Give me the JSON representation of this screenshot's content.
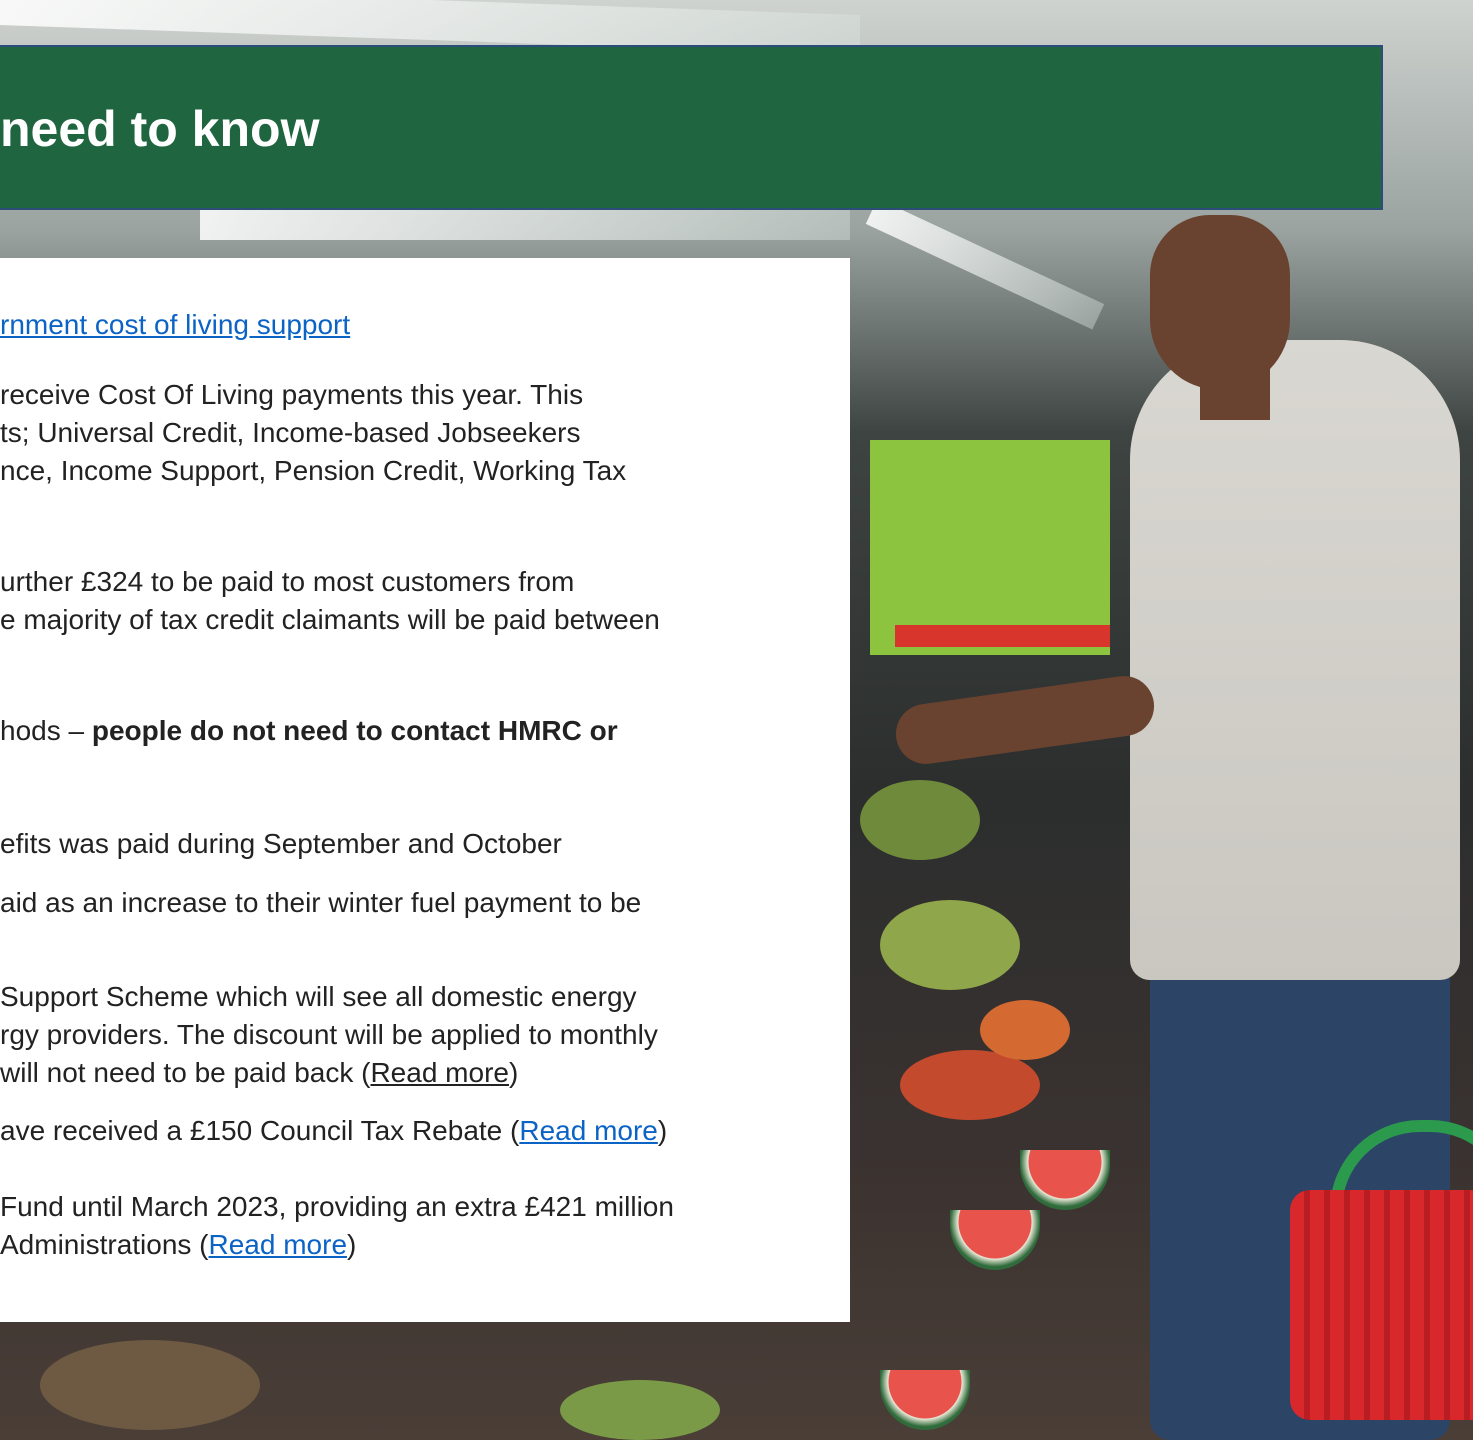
{
  "banner": {
    "title": "need to know"
  },
  "panel": {
    "top_link": "rnment cost of living support",
    "para1": [
      "receive Cost Of Living payments this year. This",
      "ts; Universal Credit, Income-based Jobseekers",
      "nce, Income Support, Pension Credit, Working Tax"
    ],
    "para2": [
      "urther £324 to be paid to most customers from",
      "e majority of tax credit claimants will be paid between"
    ],
    "para3": {
      "prefix": "hods – ",
      "bold": "people do not need to contact HMRC or"
    },
    "para4": "efits was paid during September and October",
    "para5": "aid as an increase to their winter fuel payment to be",
    "para6": [
      "Support Scheme which will see all domestic energy",
      "rgy providers. The discount will be applied to monthly"
    ],
    "para6_last": {
      "prefix": " will not need to be paid back (",
      "link": "Read more",
      "suffix": ")"
    },
    "para7": {
      "prefix": "ave received a £150 Council Tax Rebate (",
      "link": "Read more",
      "suffix": ")"
    },
    "para8": "Fund until March 2023, providing an extra £421 million",
    "para8_last": {
      "prefix": "Administrations (",
      "link": "Read more",
      "suffix": ")"
    }
  }
}
